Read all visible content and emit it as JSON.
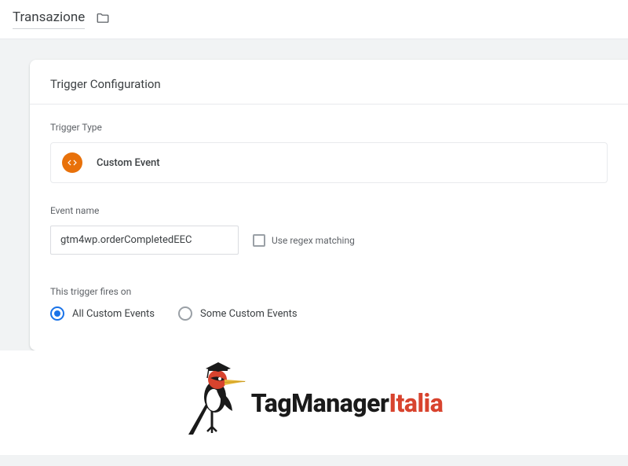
{
  "header": {
    "title": "Transazione"
  },
  "card": {
    "title": "Trigger Configuration",
    "trigger_type_label": "Trigger Type",
    "trigger_type_value": "Custom Event",
    "event_name_label": "Event name",
    "event_name_value": "gtm4wp.orderCompletedEEC",
    "regex_label": "Use regex matching",
    "regex_checked": false,
    "fires_on_label": "This trigger fires on",
    "fires_on_options": [
      {
        "label": "All Custom Events",
        "selected": true
      },
      {
        "label": "Some Custom Events",
        "selected": false
      }
    ]
  },
  "logo": {
    "part1": "TagManager",
    "part2": "Italia"
  },
  "colors": {
    "accent_orange": "#e8710a",
    "accent_blue": "#1a73e8",
    "logo_red": "#d8432e"
  }
}
